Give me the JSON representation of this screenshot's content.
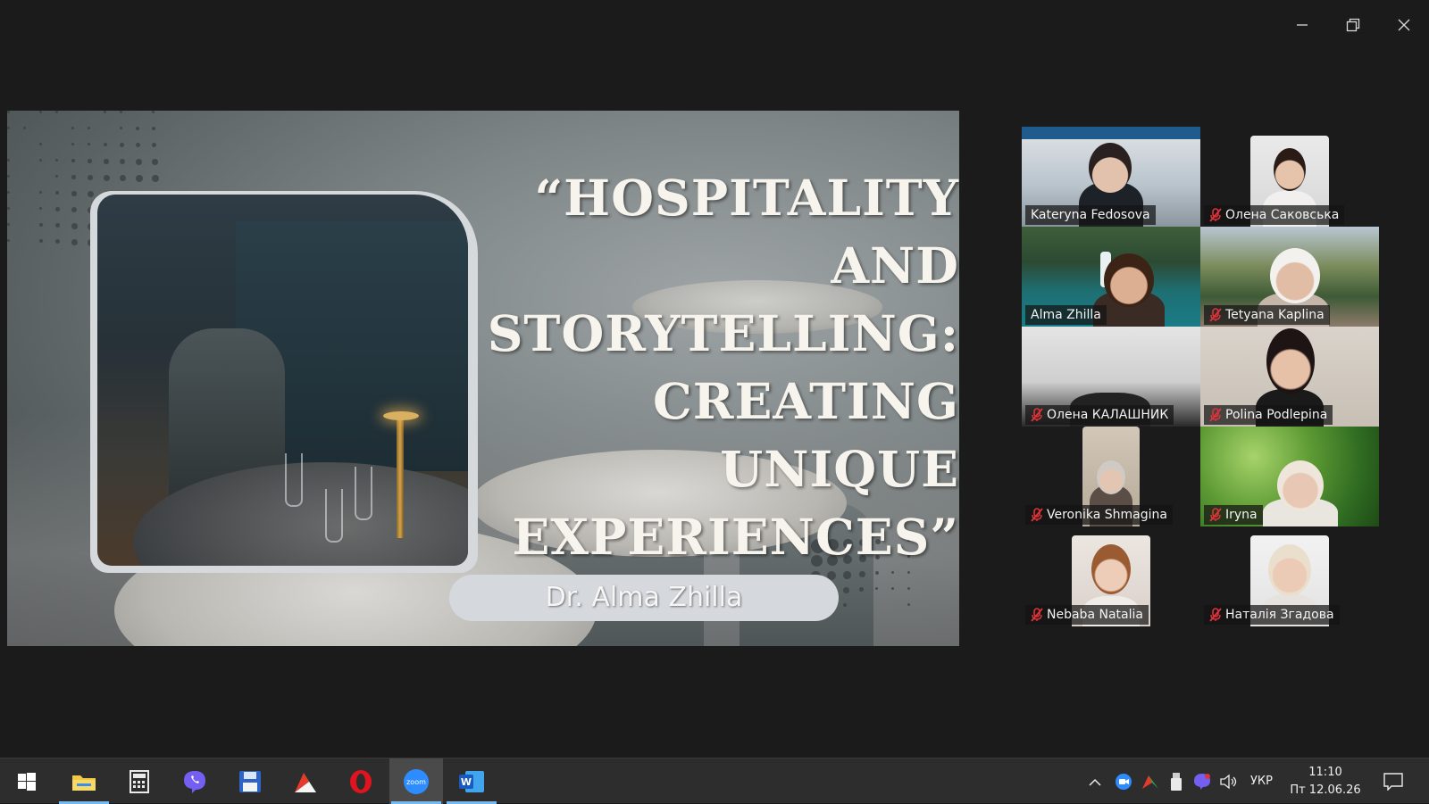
{
  "slide": {
    "title_lines": [
      "“HOSPITALITY",
      "AND",
      "STORYTELLING:",
      "CREATING",
      "UNIQUE",
      "EXPERIENCES”"
    ],
    "presenter": "Dr. Alma Zhilla"
  },
  "window_controls": [
    "minimize-icon",
    "restore-icon",
    "close-icon"
  ],
  "participants": [
    {
      "name": "Kateryna Fedosova",
      "muted": false
    },
    {
      "name": "Олена Саковська",
      "muted": true
    },
    {
      "name": "Alma Zhilla",
      "muted": false,
      "active_speaker": true
    },
    {
      "name": "Tetyana Kaplina",
      "muted": true
    },
    {
      "name": "Олена КАЛАШНИК",
      "muted": true
    },
    {
      "name": "Polina Podlepina",
      "muted": true
    },
    {
      "name": "Veronika Shmagina",
      "muted": true
    },
    {
      "name": "Iryna",
      "muted": true
    },
    {
      "name": "Nebaba Natalia",
      "muted": true
    },
    {
      "name": "Наталія Згадова",
      "muted": true
    }
  ],
  "taskbar": {
    "apps": [
      "start-icon",
      "file-explorer-icon",
      "calculator-icon",
      "viber-icon",
      "floppy-save-icon",
      "app-icon",
      "opera-icon",
      "zoom-icon",
      "word-icon"
    ],
    "zoom_label": "zoom",
    "word_label": "W",
    "language": "УКР",
    "time": "11:10",
    "date": "Пт 12.06.26"
  },
  "colors": {
    "active_speaker": "#3ddc84",
    "mute_icon": "#e0323a",
    "taskbar_indicator": "#76b9ed"
  }
}
